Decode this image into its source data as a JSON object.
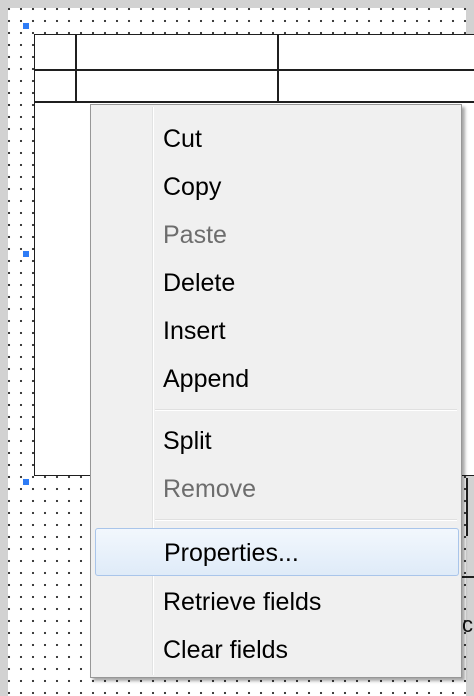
{
  "context_menu": {
    "items": [
      {
        "label": "Cut",
        "enabled": true
      },
      {
        "label": "Copy",
        "enabled": true
      },
      {
        "label": "Paste",
        "enabled": false
      },
      {
        "label": "Delete",
        "enabled": true
      },
      {
        "label": "Insert",
        "enabled": true
      },
      {
        "label": "Append",
        "enabled": true
      },
      {
        "label": "Split",
        "enabled": true
      },
      {
        "label": "Remove",
        "enabled": false
      },
      {
        "label": "Properties...",
        "enabled": true,
        "highlighted": true
      },
      {
        "label": "Retrieve fields",
        "enabled": true
      },
      {
        "label": "Clear fields",
        "enabled": true
      }
    ]
  },
  "colors": {
    "selection_handle": "#2e7cf6",
    "menu_background": "#f0f0f0",
    "hover_border": "#a9c5ea",
    "disabled_text": "#6d6d6d"
  },
  "clipped_text": "c"
}
